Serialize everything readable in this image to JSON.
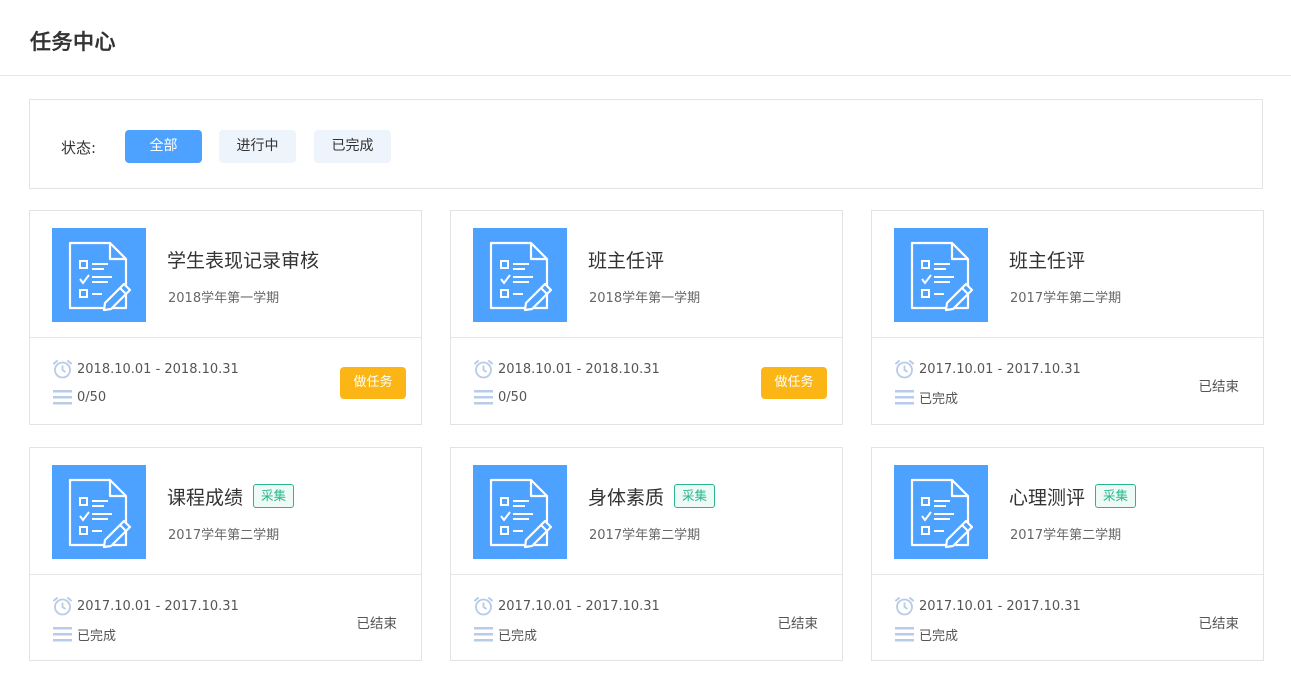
{
  "header": {
    "title": "任务中心"
  },
  "filter": {
    "label": "状态:",
    "options": [
      {
        "label": "全部",
        "active": true
      },
      {
        "label": "进行中",
        "active": false
      },
      {
        "label": "已完成",
        "active": false
      }
    ]
  },
  "cards": [
    {
      "title": "学生表现记录审核",
      "tag": "",
      "term": "2018学年第一学期",
      "date_range": "2018.10.01 - 2018.10.31",
      "progress": "0/50",
      "action": "做任务",
      "status": ""
    },
    {
      "title": "班主任评",
      "tag": "",
      "term": "2018学年第一学期",
      "date_range": "2018.10.01 - 2018.10.31",
      "progress": "0/50",
      "action": "做任务",
      "status": ""
    },
    {
      "title": "班主任评",
      "tag": "",
      "term": "2017学年第二学期",
      "date_range": "2017.10.01 - 2017.10.31",
      "progress": "已完成",
      "action": "",
      "status": "已结束"
    },
    {
      "title": "课程成绩",
      "tag": "采集",
      "term": "2017学年第二学期",
      "date_range": "2017.10.01 - 2017.10.31",
      "progress": "已完成",
      "action": "",
      "status": "已结束"
    },
    {
      "title": "身体素质",
      "tag": "采集",
      "term": "2017学年第二学期",
      "date_range": "2017.10.01 - 2017.10.31",
      "progress": "已完成",
      "action": "",
      "status": "已结束"
    },
    {
      "title": "心理测评",
      "tag": "采集",
      "term": "2017学年第二学期",
      "date_range": "2017.10.01 - 2017.10.31",
      "progress": "已完成",
      "action": "",
      "status": "已结束"
    }
  ],
  "icons": {
    "thumbnail": "task-document-edit-icon",
    "date": "alarm-clock-icon",
    "progress": "list-lines-icon"
  },
  "colors": {
    "primary": "#4da1ff",
    "action": "#fbb615",
    "tag": "#27b68e",
    "icon_light": "#b8cbe8"
  }
}
